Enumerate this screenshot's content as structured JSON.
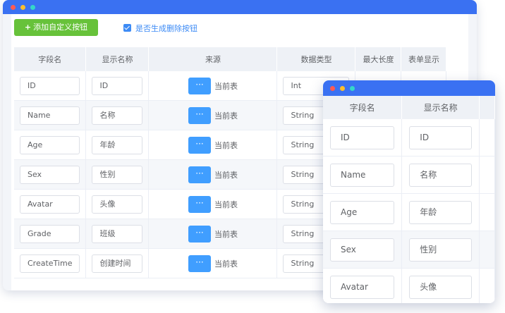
{
  "toolbar": {
    "add_button_label": "添加自定义按钮",
    "add_button_plus": "+",
    "delete_checkbox_label": "是否生成删除按钮",
    "delete_checkbox_checked": true
  },
  "table": {
    "headers": [
      "字段名",
      "显示名称",
      "来源",
      "数据类型",
      "最大长度",
      "表单显示"
    ],
    "source_button_icon": "···",
    "rows": [
      {
        "field": "ID",
        "display": "ID",
        "source": "当前表",
        "type": "Int"
      },
      {
        "field": "Name",
        "display": "名称",
        "source": "当前表",
        "type": "String"
      },
      {
        "field": "Age",
        "display": "年龄",
        "source": "当前表",
        "type": "String"
      },
      {
        "field": "Sex",
        "display": "性别",
        "source": "当前表",
        "type": "String"
      },
      {
        "field": "Avatar",
        "display": "头像",
        "source": "当前表",
        "type": "String"
      },
      {
        "field": "Grade",
        "display": "班级",
        "source": "当前表",
        "type": "String"
      },
      {
        "field": "CreateTime",
        "display": "创建时间",
        "source": "当前表",
        "type": "String"
      }
    ]
  },
  "zoom_panel": {
    "headers": [
      "字段名",
      "显示名称"
    ],
    "rows": [
      {
        "field": "ID",
        "display": "ID"
      },
      {
        "field": "Name",
        "display": "名称"
      },
      {
        "field": "Age",
        "display": "年龄"
      },
      {
        "field": "Sex",
        "display": "性别"
      },
      {
        "field": "Avatar",
        "display": "头像"
      }
    ]
  },
  "colors": {
    "titlebar": "#3a71f2",
    "add_button": "#67c23a",
    "source_button": "#409eff",
    "checkbox": "#3d8bf5"
  }
}
